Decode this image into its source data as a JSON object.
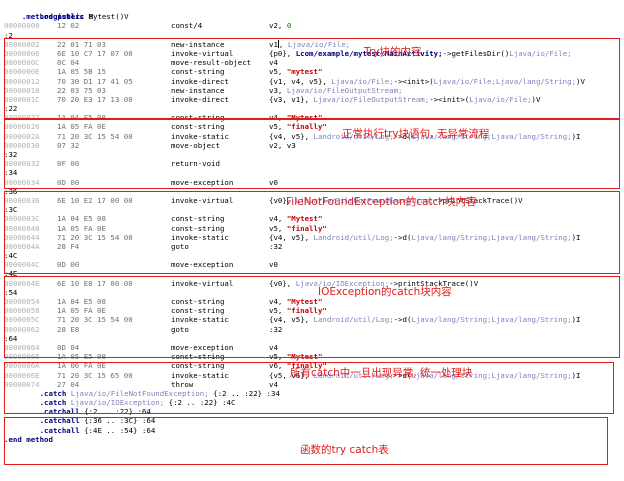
{
  "header": {
    "method_decl_keyword": ".method public",
    "method_decl_name": "Mytest()V",
    "registers_label": ".registers",
    "registers_value": "8"
  },
  "rows": [
    {
      "kind": "code",
      "off": "00000000",
      "hex": "12 02",
      "op": "const/4",
      "args": [
        [
          "plain",
          "v2, "
        ],
        [
          "num",
          "0"
        ]
      ]
    },
    {
      "kind": "label",
      "text": ":2"
    },
    {
      "kind": "code",
      "off": "00000002",
      "hex": "22 01 71 03",
      "op": "new-instance",
      "args": [
        [
          "plain",
          "v1"
        ],
        [
          "cursor",
          ""
        ],
        [
          "plain",
          ", "
        ],
        [
          "typ",
          "Ljava/io/File;"
        ]
      ]
    },
    {
      "kind": "code",
      "off": "00000006",
      "hex": "6E 10 C7 17 07 00",
      "op": "invoke-virtual",
      "args": [
        [
          "plain",
          "{p0}, "
        ],
        [
          "kw",
          "Lcom/example/mytest/MainActivity;"
        ],
        [
          "plain",
          "->getFilesDir()"
        ],
        [
          "typ",
          "Ljava/io/File;"
        ]
      ]
    },
    {
      "kind": "code",
      "off": "0000000C",
      "hex": "0C 04",
      "op": "move-result-object",
      "args": [
        [
          "plain",
          "v4"
        ]
      ]
    },
    {
      "kind": "code",
      "off": "0000000E",
      "hex": "1A 05 5B 15",
      "op": "const-string",
      "args": [
        [
          "plain",
          "v5, "
        ],
        [
          "str",
          "\"mytest\""
        ]
      ]
    },
    {
      "kind": "code",
      "off": "00000012",
      "hex": "70 30 D1 17 41 05",
      "op": "invoke-direct",
      "args": [
        [
          "plain",
          "{v1, v4, v5}, "
        ],
        [
          "typ",
          "Ljava/io/File;"
        ],
        [
          "plain",
          "-><init>("
        ],
        [
          "typ",
          "Ljava/io/File;Ljava/lang/String;"
        ],
        [
          "plain",
          ")V"
        ]
      ]
    },
    {
      "kind": "code",
      "off": "00000018",
      "hex": "22 03 75 03",
      "op": "new-instance",
      "args": [
        [
          "plain",
          "v3, "
        ],
        [
          "typ",
          "Ljava/io/FileOutputStream;"
        ]
      ]
    },
    {
      "kind": "code",
      "off": "0000001C",
      "hex": "70 20 E3 17 13 00",
      "op": "invoke-direct",
      "args": [
        [
          "plain",
          "{v3, v1}, "
        ],
        [
          "typ",
          "Ljava/io/FileOutputStream;"
        ],
        [
          "plain",
          "-><init>("
        ],
        [
          "typ",
          "Ljava/io/File;"
        ],
        [
          "plain",
          ")V"
        ]
      ]
    },
    {
      "kind": "label",
      "text": ":22"
    },
    {
      "kind": "code",
      "off": "00000022",
      "hex": "1A 04 E5 08",
      "op": "const-string",
      "args": [
        [
          "plain",
          "v4, "
        ],
        [
          "str",
          "\"Mytest\""
        ]
      ]
    },
    {
      "kind": "code",
      "off": "00000026",
      "hex": "1A 05 FA 0E",
      "op": "const-string",
      "args": [
        [
          "plain",
          "v5, "
        ],
        [
          "str",
          "\"finally\""
        ]
      ]
    },
    {
      "kind": "code",
      "off": "0000002A",
      "hex": "71 20 3C 15 54 00",
      "op": "invoke-static",
      "args": [
        [
          "plain",
          "{v4, v5}, "
        ],
        [
          "typ",
          "Landroid/util/Log;"
        ],
        [
          "plain",
          "->d("
        ],
        [
          "typ",
          "Ljava/lang/String;Ljava/lang/String;"
        ],
        [
          "plain",
          ")I"
        ]
      ]
    },
    {
      "kind": "code",
      "off": "00000030",
      "hex": "07 32",
      "op": "move-object",
      "args": [
        [
          "plain",
          "v2, v3"
        ]
      ]
    },
    {
      "kind": "label",
      "text": ":32"
    },
    {
      "kind": "code",
      "off": "00000032",
      "hex": "0F 00",
      "op": "return-void",
      "args": []
    },
    {
      "kind": "label",
      "text": ":34"
    },
    {
      "kind": "code",
      "off": "00000034",
      "hex": "0D 00",
      "op": "move-exception",
      "args": [
        [
          "plain",
          "v0"
        ]
      ]
    },
    {
      "kind": "label",
      "text": ":36"
    },
    {
      "kind": "code",
      "off": "00000036",
      "hex": "6E 10 E2 17 00 00",
      "op": "invoke-virtual",
      "args": [
        [
          "plain",
          "{v0}, "
        ],
        [
          "typ",
          "Ljava/io/FileNotFoundException;"
        ],
        [
          "plain",
          "->printStackTrace()V"
        ]
      ]
    },
    {
      "kind": "label",
      "text": ":3C"
    },
    {
      "kind": "code",
      "off": "0000003C",
      "hex": "1A 04 E5 08",
      "op": "const-string",
      "args": [
        [
          "plain",
          "v4, "
        ],
        [
          "str",
          "\"Mytest\""
        ]
      ]
    },
    {
      "kind": "code",
      "off": "00000040",
      "hex": "1A 05 FA 0E",
      "op": "const-string",
      "args": [
        [
          "plain",
          "v5, "
        ],
        [
          "str",
          "\"finally\""
        ]
      ]
    },
    {
      "kind": "code",
      "off": "00000044",
      "hex": "71 20 3C 15 54 00",
      "op": "invoke-static",
      "args": [
        [
          "plain",
          "{v4, v5}, "
        ],
        [
          "typ",
          "Landroid/util/Log;"
        ],
        [
          "plain",
          "->d("
        ],
        [
          "typ",
          "Ljava/lang/String;Ljava/lang/String;"
        ],
        [
          "plain",
          ")I"
        ]
      ]
    },
    {
      "kind": "code",
      "off": "0000004A",
      "hex": "28 F4",
      "op": "goto",
      "args": [
        [
          "plain",
          ":32"
        ]
      ]
    },
    {
      "kind": "label",
      "text": ":4C"
    },
    {
      "kind": "code",
      "off": "0000004C",
      "hex": "0D 00",
      "op": "move-exception",
      "args": [
        [
          "plain",
          "v0"
        ]
      ]
    },
    {
      "kind": "label",
      "text": ":4E"
    },
    {
      "kind": "code",
      "off": "0000004E",
      "hex": "6E 10 E8 17 00 00",
      "op": "invoke-virtual",
      "args": [
        [
          "plain",
          "{v0}, "
        ],
        [
          "typ",
          "Ljava/io/IOException;"
        ],
        [
          "plain",
          "->printStackTrace()V"
        ]
      ]
    },
    {
      "kind": "label",
      "text": ":54"
    },
    {
      "kind": "code",
      "off": "00000054",
      "hex": "1A 04 E5 08",
      "op": "const-string",
      "args": [
        [
          "plain",
          "v4, "
        ],
        [
          "str",
          "\"Mytest\""
        ]
      ]
    },
    {
      "kind": "code",
      "off": "00000058",
      "hex": "1A 05 FA 0E",
      "op": "const-string",
      "args": [
        [
          "plain",
          "v5, "
        ],
        [
          "str",
          "\"finally\""
        ]
      ]
    },
    {
      "kind": "code",
      "off": "0000005C",
      "hex": "71 20 3C 15 54 00",
      "op": "invoke-static",
      "args": [
        [
          "plain",
          "{v4, v5}, "
        ],
        [
          "typ",
          "Landroid/util/Log;"
        ],
        [
          "plain",
          "->d("
        ],
        [
          "typ",
          "Ljava/lang/String;Ljava/lang/String;"
        ],
        [
          "plain",
          ")I"
        ]
      ]
    },
    {
      "kind": "code",
      "off": "00000062",
      "hex": "28 E8",
      "op": "goto",
      "args": [
        [
          "plain",
          ":32"
        ]
      ]
    },
    {
      "kind": "label",
      "text": ":64"
    },
    {
      "kind": "code",
      "off": "00000064",
      "hex": "0D 04",
      "op": "move-exception",
      "args": [
        [
          "plain",
          "v4"
        ]
      ]
    },
    {
      "kind": "code",
      "off": "00000066",
      "hex": "1A 05 E5 08",
      "op": "const-string",
      "args": [
        [
          "plain",
          "v5, "
        ],
        [
          "str",
          "\"Mytest\""
        ]
      ]
    },
    {
      "kind": "code",
      "off": "0000006A",
      "hex": "1A 06 FA 0E",
      "op": "const-string",
      "args": [
        [
          "plain",
          "v6, "
        ],
        [
          "str",
          "\"finally\""
        ]
      ]
    },
    {
      "kind": "code",
      "off": "0000006E",
      "hex": "71 20 3C 15 65 00",
      "op": "invoke-static",
      "args": [
        [
          "plain",
          "{v5, v6}, "
        ],
        [
          "typ",
          "Landroid/util/Log;"
        ],
        [
          "plain",
          "->d("
        ],
        [
          "typ",
          "Ljava/lang/String;Ljava/lang/String;"
        ],
        [
          "plain",
          ")I"
        ]
      ]
    },
    {
      "kind": "code",
      "off": "00000074",
      "hex": "27 04",
      "op": "throw",
      "args": [
        [
          "plain",
          "v4"
        ]
      ]
    },
    {
      "kind": "catch",
      "dir": ".catch",
      "typ": "Ljava/io/FileNotFoundException;",
      "rest": " {:2 .. :22} :34"
    },
    {
      "kind": "catch",
      "dir": ".catch",
      "typ": "Ljava/io/IOException;",
      "rest": " {:2 .. :22} :4C"
    },
    {
      "kind": "catch",
      "dir": ".catchall",
      "typ": "",
      "rest": "{:2 .. :22} :64"
    },
    {
      "kind": "catch",
      "dir": ".catchall",
      "typ": "",
      "rest": "{:36 .. :3C} :64"
    },
    {
      "kind": "catch",
      "dir": ".catchall",
      "typ": "",
      "rest": "{:4E .. :54} :64"
    },
    {
      "kind": "end",
      "text": ".end method"
    }
  ],
  "annotations": {
    "try_block": "Try块的内容",
    "normal_flow": "正常执行try块语句, 无异常流程",
    "fnf_catch": "FileNotFoundException的catch块内容",
    "io_catch": "IOException的catch块内容",
    "catchall": "所有catch中一旦出现异常, 统一处理块",
    "try_table": "函数的try catch表"
  },
  "colors": {
    "annotation_red": "#e21b1b",
    "directive_blue": "#000080",
    "type_purple": "#7f7fbf",
    "string_red": "#cc0000",
    "number_green": "#008000",
    "offset_gray": "#b0b0b0"
  }
}
